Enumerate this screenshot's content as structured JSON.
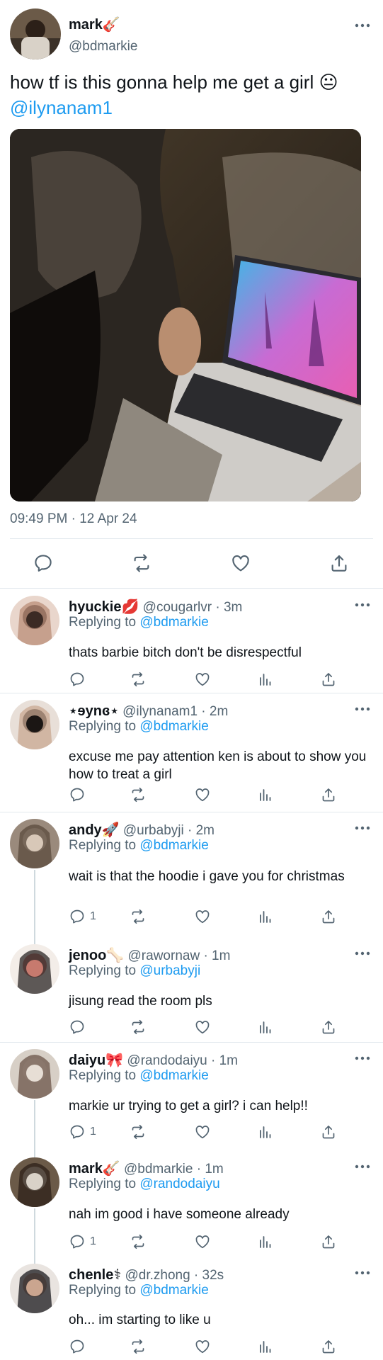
{
  "tweet": {
    "author_name": "mark🎸",
    "author_handle": "@bdmarkie",
    "text": "how tf is this gonna help me get a girl 😐",
    "mention": "@ilynanam1",
    "timestamp": "09:49 PM · 12 Apr 24"
  },
  "replies": [
    {
      "name": "hyuckie💋",
      "handle": "@cougarlvr · 3m",
      "replying_prefix": "Replying to ",
      "replying_to": "@bdmarkie",
      "text": "thats barbie bitch don't be disrespectful",
      "reply_count": ""
    },
    {
      "name": "⋆ɘynɞ⋆",
      "handle": "@ilynanam1 · 2m",
      "replying_prefix": "Replying to ",
      "replying_to": "@bdmarkie",
      "text": "excuse me pay attention ken is about to show you how to treat a girl",
      "reply_count": ""
    },
    {
      "name": "andy🚀",
      "handle": "@urbabyji · 2m",
      "replying_prefix": "Replying to ",
      "replying_to": "@bdmarkie",
      "text": "wait is that the hoodie i gave you for christmas",
      "reply_count": "1"
    },
    {
      "name": "jenoo🦴",
      "handle": "@rawornaw · 1m",
      "replying_prefix": "Replying to ",
      "replying_to": "@urbabyji",
      "text": "jisung read the room pls",
      "reply_count": ""
    },
    {
      "name": "daiyu🎀",
      "handle": "@randodaiyu · 1m",
      "replying_prefix": "Replying to ",
      "replying_to": "@bdmarkie",
      "text": "markie ur trying to get a girl? i can help!!",
      "reply_count": "1"
    },
    {
      "name": "mark🎸",
      "handle": "@bdmarkie · 1m",
      "replying_prefix": "Replying to ",
      "replying_to": "@randodaiyu",
      "text": "nah im good i have someone already",
      "reply_count": "1"
    },
    {
      "name": "chenle⚕",
      "handle": "@dr.zhong · 32s",
      "replying_prefix": "Replying to ",
      "replying_to": "@bdmarkie",
      "text": "oh... im starting to like u",
      "reply_count": ""
    }
  ],
  "colors": {
    "accent": "#1d9bf0",
    "muted": "#536471",
    "divider": "#e1e8ed"
  },
  "icons": [
    "reply-icon",
    "retweet-icon",
    "like-icon",
    "views-icon",
    "share-icon",
    "more-icon"
  ]
}
